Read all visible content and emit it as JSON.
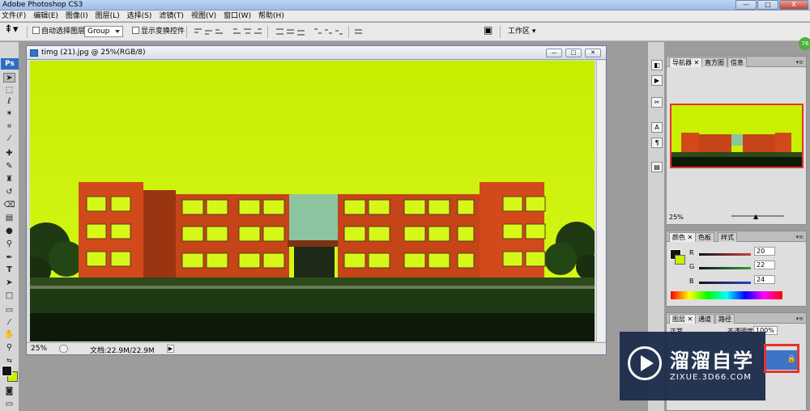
{
  "window": {
    "title": "Adobe Photoshop CS3",
    "controls": {
      "minimize": "—",
      "maximize": "□",
      "close": "X"
    }
  },
  "menubar": [
    "文件(F)",
    "编辑(E)",
    "图像(I)",
    "图层(L)",
    "选择(S)",
    "滤镜(T)",
    "视图(V)",
    "窗口(W)",
    "帮助(H)"
  ],
  "options": {
    "auto_select_label": "自动选择图层",
    "auto_select_mode": "Group",
    "show_transform_label": "显示变换控件",
    "workspace_label": "工作区"
  },
  "toolbox": {
    "logo": "Ps"
  },
  "document": {
    "title": "timg (21).jpg @ 25%(RGB/8)",
    "zoom": "25%",
    "doc_info": "文档:22.9M/22.9M"
  },
  "panels": {
    "navigator": {
      "tabs": [
        "导航器",
        "直方图",
        "信息"
      ],
      "zoom": "25%"
    },
    "color": {
      "tabs": [
        "颜色",
        "色板",
        "样式"
      ],
      "channels": [
        {
          "label": "R",
          "value": "20",
          "color": "#d23b3b"
        },
        {
          "label": "G",
          "value": "22",
          "color": "#33a033"
        },
        {
          "label": "B",
          "value": "24",
          "color": "#2b45c2"
        }
      ]
    },
    "layers": {
      "tabs": [
        "图层",
        "通道",
        "路径"
      ],
      "blend_mode": "正常",
      "opacity_label": "不透明度:",
      "opacity": "100%"
    }
  },
  "watermark": {
    "title": "溜溜自学",
    "subtitle": "ZIXUE.3D66.COM"
  },
  "badge": "76"
}
